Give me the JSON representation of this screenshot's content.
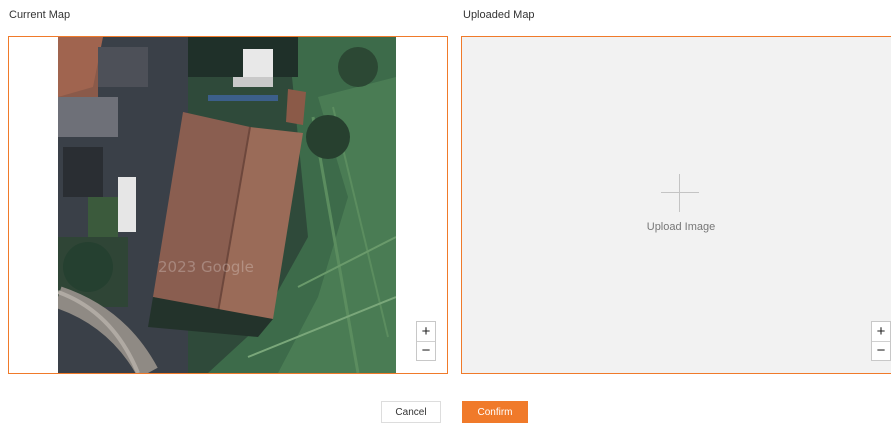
{
  "current_map": {
    "label": "Current Map",
    "watermark": "2023 Google",
    "zoom_in_label": "+",
    "zoom_out_label": "−"
  },
  "uploaded_map": {
    "label": "Uploaded Map",
    "upload_text": "Upload Image",
    "zoom_in_label": "+",
    "zoom_out_label": "−"
  },
  "footer": {
    "cancel_label": "Cancel",
    "confirm_label": "Confirm"
  },
  "colors": {
    "accent": "#f07a2a",
    "upload_background": "#f2f2f2"
  }
}
